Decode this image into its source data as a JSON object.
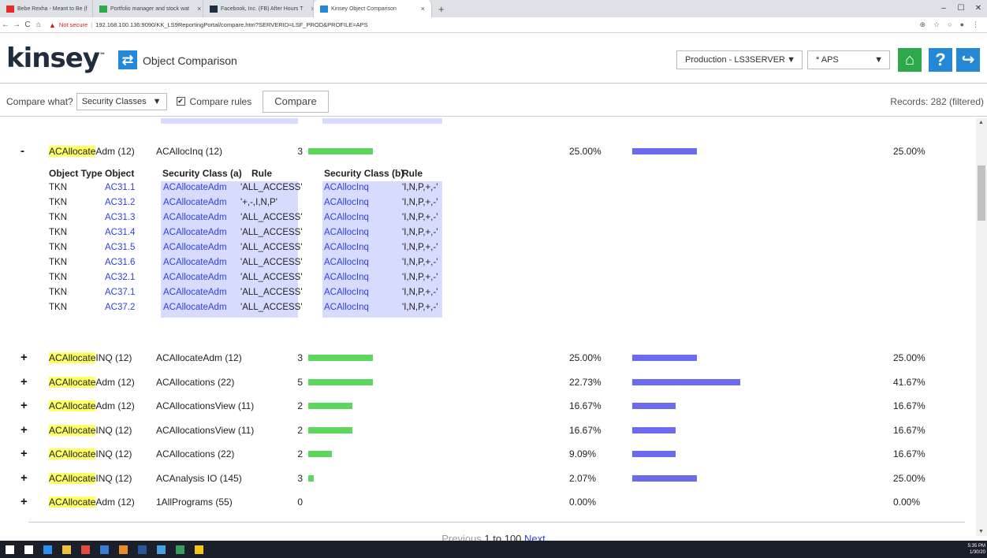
{
  "browser": {
    "tabs": [
      {
        "title": "Bebe Rexha - Meant to Be (f",
        "favicon_color": "#e52d27",
        "active": false
      },
      {
        "title": "Portfolio manager and stock wat",
        "favicon_color": "#2da84a",
        "active": false
      },
      {
        "title": "Facebook, Inc. (FB) After Hours T",
        "favicon_color": "#1f2d3d",
        "active": false
      },
      {
        "title": "Kinsey Object Comparison",
        "favicon_color": "#2389d6",
        "active": true
      }
    ],
    "new_tab": "+",
    "not_secure": "Not secure",
    "url": "192.168.100.136:9090/KK_LS9ReportingPortal/compare.htm?SERVERID=LSF_PROD&PROFILE=APS"
  },
  "app": {
    "logo": "kinsey",
    "logo_tm": "™",
    "title": "Object Comparison",
    "environment": "Production - LS3SERVER",
    "profile": "* APS"
  },
  "toolbar": {
    "compare_what_label": "Compare what?",
    "compare_what_value": "Security Classes",
    "compare_rules_label": "Compare rules",
    "compare_button": "Compare",
    "records": "Records: 282 (filtered)"
  },
  "expanded": {
    "toggle": "-",
    "a_highlight": "ACAllocate",
    "a_rest": "Adm (12)",
    "b": "ACAllocInq (12)",
    "count": "3",
    "bar_a_pct": 25,
    "pct_a": "25.00%",
    "bar_b_pct": 25,
    "pct_b": "25.00%",
    "headers": {
      "object_type": "Object Type",
      "object": "Object",
      "sec_a": "Security Class (a)",
      "rule_a": "Rule",
      "sec_b": "Security Class (b)",
      "rule_b": "Rule"
    },
    "rows": [
      {
        "type": "TKN",
        "object": "AC31.1",
        "sec_a": "ACAllocateAdm",
        "rule_a": "'ALL_ACCESS'",
        "sec_b": "ACAllocInq",
        "rule_b": "'I,N,P,+,-'"
      },
      {
        "type": "TKN",
        "object": "AC31.2",
        "sec_a": "ACAllocateAdm",
        "rule_a": "'+,-,I,N,P'",
        "sec_b": "ACAllocInq",
        "rule_b": "'I,N,P,+,-'"
      },
      {
        "type": "TKN",
        "object": "AC31.3",
        "sec_a": "ACAllocateAdm",
        "rule_a": "'ALL_ACCESS'",
        "sec_b": "ACAllocInq",
        "rule_b": "'I,N,P,+,-'"
      },
      {
        "type": "TKN",
        "object": "AC31.4",
        "sec_a": "ACAllocateAdm",
        "rule_a": "'ALL_ACCESS'",
        "sec_b": "ACAllocInq",
        "rule_b": "'I,N,P,+,-'"
      },
      {
        "type": "TKN",
        "object": "AC31.5",
        "sec_a": "ACAllocateAdm",
        "rule_a": "'ALL_ACCESS'",
        "sec_b": "ACAllocInq",
        "rule_b": "'I,N,P,+,-'"
      },
      {
        "type": "TKN",
        "object": "AC31.6",
        "sec_a": "ACAllocateAdm",
        "rule_a": "'ALL_ACCESS'",
        "sec_b": "ACAllocInq",
        "rule_b": "'I,N,P,+,-'"
      },
      {
        "type": "TKN",
        "object": "AC32.1",
        "sec_a": "ACAllocateAdm",
        "rule_a": "'ALL_ACCESS'",
        "sec_b": "ACAllocInq",
        "rule_b": "'I,N,P,+,-'"
      },
      {
        "type": "TKN",
        "object": "AC37.1",
        "sec_a": "ACAllocateAdm",
        "rule_a": "'ALL_ACCESS'",
        "sec_b": "ACAllocInq",
        "rule_b": "'I,N,P,+,-'"
      },
      {
        "type": "TKN",
        "object": "AC37.2",
        "sec_a": "ACAllocateAdm",
        "rule_a": "'ALL_ACCESS'",
        "sec_b": "ACAllocInq",
        "rule_b": "'I,N,P,+,-'"
      }
    ]
  },
  "results": [
    {
      "toggle": "+",
      "a_highlight": "ACAllocate",
      "a_rest": "INQ (12)",
      "b": "ACAllocateAdm (12)",
      "count": "3",
      "bar_a_pct": 25,
      "pct_a": "25.00%",
      "bar_b_pct": 25,
      "pct_b": "25.00%"
    },
    {
      "toggle": "+",
      "a_highlight": "ACAllocate",
      "a_rest": "Adm (12)",
      "b": "ACAllocations (22)",
      "count": "5",
      "bar_a_pct": 25,
      "pct_a": "22.73%",
      "bar_b_pct": 41.67,
      "pct_b": "41.67%"
    },
    {
      "toggle": "+",
      "a_highlight": "ACAllocate",
      "a_rest": "Adm (12)",
      "b": "ACAllocationsView (11)",
      "count": "2",
      "bar_a_pct": 17,
      "pct_a": "16.67%",
      "bar_b_pct": 16.67,
      "pct_b": "16.67%"
    },
    {
      "toggle": "+",
      "a_highlight": "ACAllocate",
      "a_rest": "INQ (12)",
      "b": "ACAllocationsView (11)",
      "count": "2",
      "bar_a_pct": 17,
      "pct_a": "16.67%",
      "bar_b_pct": 16.67,
      "pct_b": "16.67%"
    },
    {
      "toggle": "+",
      "a_highlight": "ACAllocate",
      "a_rest": "INQ (12)",
      "b": "ACAllocations (22)",
      "count": "2",
      "bar_a_pct": 9,
      "pct_a": "9.09%",
      "bar_b_pct": 16.67,
      "pct_b": "16.67%"
    },
    {
      "toggle": "+",
      "a_highlight": "ACAllocate",
      "a_rest": "INQ (12)",
      "b": "ACAnalysis IO (145)",
      "count": "3",
      "bar_a_pct": 2,
      "pct_a": "2.07%",
      "bar_b_pct": 25,
      "pct_b": "25.00%"
    },
    {
      "toggle": "+",
      "a_highlight": "ACAllocate",
      "a_rest": "Adm (12)",
      "b": "1AllPrograms (55)",
      "count": "0",
      "bar_a_pct": 0,
      "pct_a": "0.00%",
      "bar_b_pct": 0,
      "pct_b": "0.00%"
    }
  ],
  "pager": {
    "previous": "Previous",
    "range": "1 to 100",
    "next": "Next"
  },
  "taskbar": {
    "icons": [
      {
        "name": "windows-start-icon",
        "color": "#ffffff"
      },
      {
        "name": "task-view-icon",
        "color": "#ffffff"
      },
      {
        "name": "edge-icon",
        "color": "#2d8ff0"
      },
      {
        "name": "file-explorer-icon",
        "color": "#f0c040"
      },
      {
        "name": "chrome-icon",
        "color": "#e54b3c"
      },
      {
        "name": "mail-icon",
        "color": "#3a7bd5"
      },
      {
        "name": "app-icon-1",
        "color": "#e88b2c"
      },
      {
        "name": "word-icon",
        "color": "#2b5797"
      },
      {
        "name": "app-icon-2",
        "color": "#4a9fe0"
      },
      {
        "name": "app-icon-3",
        "color": "#3a9d5d"
      },
      {
        "name": "app-icon-4",
        "color": "#f5c518"
      }
    ],
    "time": "5:35 PM",
    "date": "1/30/20"
  }
}
